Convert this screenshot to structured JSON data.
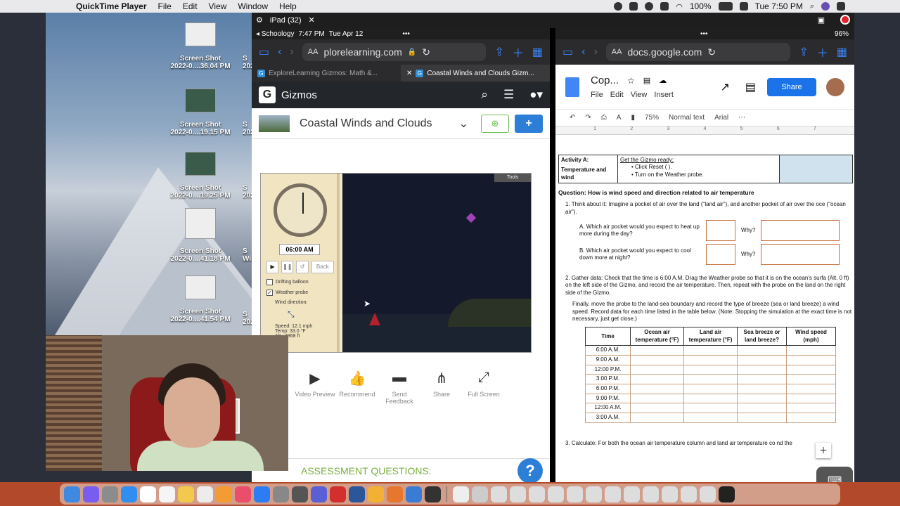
{
  "menubar": {
    "app_name": "QuickTime Player",
    "menus": [
      "File",
      "Edit",
      "View",
      "Window",
      "Help"
    ],
    "battery": "100%",
    "clock": "Tue 7:50 PM"
  },
  "desktop": {
    "files": [
      {
        "name": "Screen Shot",
        "detail": "2022-0....36.04 PM"
      },
      {
        "name": "Screen Shot",
        "detail": "2022-0....19.15 PM"
      },
      {
        "name": "Screen Shot",
        "detail": "2022-0....19.25 PM"
      },
      {
        "name": "Screen Shot",
        "detail": "2022-0....41.18 PM"
      },
      {
        "name": "Screen Shot",
        "detail": "2022-0....41.54 PM"
      }
    ],
    "cut_labels": [
      "S",
      "202",
      "S",
      "202",
      "S",
      "202",
      "S",
      "Window",
      "S",
      "202"
    ]
  },
  "ipad": {
    "recording_label": "iPad (32)",
    "status_time": "7:47 PM",
    "status_date": "Tue Apr 12",
    "back_app": "◂ Schoology",
    "battery": "96%"
  },
  "safari_left": {
    "url": "plorelearning.com",
    "tabs": [
      "ExploreLearning Gizmos: Math &...",
      "Coastal Winds and Clouds Gizm..."
    ]
  },
  "gizmo": {
    "brand": "Gizmos",
    "title": "Coastal Winds and Clouds",
    "time": "06:00 AM",
    "back_label": "Back",
    "tools_label": "Tools",
    "options": [
      {
        "label": "Drifting balloon",
        "checked": ""
      },
      {
        "label": "Weather probe",
        "checked": "✓"
      }
    ],
    "wind_direction_label": "Wind direction:",
    "probe": {
      "speed": "Speed: 12.1 mph",
      "temp": "Temp: 33.0 °F",
      "alt": "Alt.: 7368 ft"
    },
    "actions": [
      {
        "icon": "▶",
        "label": "Video Preview"
      },
      {
        "icon": "👍",
        "label": "Recommend"
      },
      {
        "icon": "▬",
        "label": "Send Feedback"
      },
      {
        "icon": "⋔",
        "label": "Share"
      },
      {
        "icon": "⤢",
        "label": "Full Screen"
      }
    ],
    "assessment_label": "ASSESSMENT QUESTIONS:"
  },
  "safari_right": {
    "url": "docs.google.com"
  },
  "docs": {
    "title": "Cop...",
    "menus": [
      "File",
      "Edit",
      "View",
      "Insert"
    ],
    "share_label": "Share",
    "zoom": "75%",
    "style": "Normal text",
    "font": "Arial",
    "ruler_ticks": [
      "1",
      "2",
      "3",
      "4",
      "5",
      "6",
      "7"
    ],
    "activity": {
      "label": "Activity A:",
      "sublabel": "Temperature and wind",
      "header": "Get the Gizmo ready:",
      "steps": [
        "Click Reset (  ).",
        "Turn on the Weather probe."
      ]
    },
    "question": "Question: How is wind speed and direction related to air temperature",
    "q1": "1.  Think about it: Imagine a pocket of air over the land (\"land air\"), and another pocket of air over the oce (\"ocean air\").",
    "q1a": "A.  Which air pocket would you expect to heat up more during the day?",
    "q1b": "B.  Which air pocket would you expect to cool down more at night?",
    "why": "Why?",
    "q2": "2.  Gather data: Check that the time is 6:00 A.M. Drag the Weather probe so that it is on the ocean's surfa (Alt. 0 ft) on the left side of the Gizmo, and record the air temperature. Then, repeat with the probe on the land on the right side of the Gizmo.",
    "q2b": "Finally, move the probe to the land-sea boundary and record the type of breeze (sea or land breeze) a wind speed. Record data for each time listed in the table below. (Note: Stopping the simulation at the exact time is not necessary, just get close.)",
    "table_headers": [
      "Time",
      "Ocean air temperature (°F)",
      "Land air temperature (°F)",
      "Sea breeze or land breeze?",
      "Wind speed (mph)"
    ],
    "table_times": [
      "6:00 A.M.",
      "9:00 A.M.",
      "12:00 P.M.",
      "3:00 P.M.",
      "6:00 P.M.",
      "9:00 P.M.",
      "12:00 A.M.",
      "3:00 A.M."
    ],
    "q3": "3.  Calculate: For both the ocean air temperature column and land air temperature co   nd the"
  },
  "colors": {
    "gizmo_dark": "#23262b",
    "gizmo_blue": "#2c7ed6",
    "gizmo_green": "#7bae3e",
    "docs_blue": "#1a73e8"
  }
}
